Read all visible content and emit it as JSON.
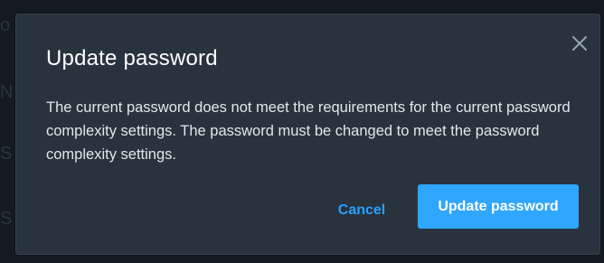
{
  "dialog": {
    "title": "Update password",
    "close_icon": "close-icon",
    "message": "The current password does not meet the requirements for the current password complexity settings. The password must be changed to meet the password complexity settings.",
    "cancel_label": "Cancel",
    "confirm_label": "Update password"
  },
  "background_text": {
    "line1": "o",
    "line2": "N",
    "line3": "S",
    "line4": "S"
  },
  "colors": {
    "backdrop": "#131a22",
    "dialog_bg": "#28333e",
    "title": "#ffffff",
    "message": "#e3e7eb",
    "link_accent": "#2ba0ff",
    "button_bg": "#2fa6ff"
  }
}
